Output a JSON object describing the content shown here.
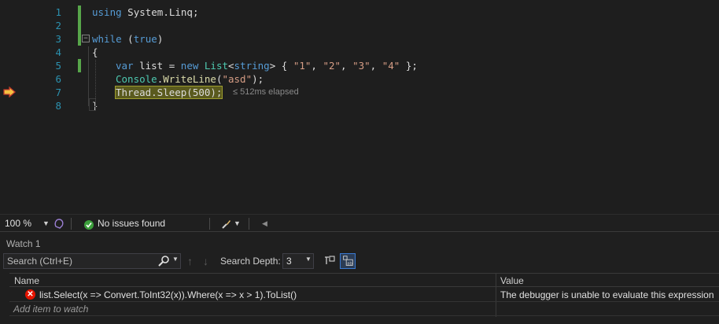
{
  "editor": {
    "lines": [
      {
        "number": "1"
      },
      {
        "number": "2"
      },
      {
        "number": "3"
      },
      {
        "number": "4"
      },
      {
        "number": "5"
      },
      {
        "number": "6"
      },
      {
        "number": "7"
      },
      {
        "number": "8"
      }
    ],
    "tokens": {
      "l1_kw": "using",
      "l1_rest": " System.Linq;",
      "l3_kw": "while",
      "l3_open": " (",
      "l3_true": "true",
      "l3_close": ")",
      "l4": "{",
      "l5_var": "var",
      "l5_a": " list = ",
      "l5_new": "new",
      "l5_sp": " ",
      "l5_list": "List",
      "l5_lt": "<",
      "l5_string": "string",
      "l5_gt": "> { ",
      "l5_s1": "\"1\"",
      "l5_c1": ", ",
      "l5_s2": "\"2\"",
      "l5_c2": ", ",
      "l5_s3": "\"3\"",
      "l5_c3": ", ",
      "l5_s4": "\"4\"",
      "l5_end": " };",
      "l6_console": "Console",
      "l6_dot": ".",
      "l6_write": "WriteLine",
      "l6_open": "(",
      "l6_str": "\"asd\"",
      "l6_close": ");",
      "l7_stmt": "Thread.Sleep(500);",
      "l8": "}"
    },
    "perf_tip": "≤ 512ms elapsed",
    "current_line_icon": "instruction-pointer-arrow-icon",
    "colors": {
      "keyword": "#569cd6",
      "type": "#4ec9b0",
      "string": "#d69d85",
      "method": "#dcdcaa",
      "change_bar": "#57a64a"
    }
  },
  "status_strip": {
    "zoom": "100 %",
    "issues": "No issues found"
  },
  "watch": {
    "title": "Watch 1",
    "search_placeholder": "Search (Ctrl+E)",
    "search_depth_label": "Search Depth:",
    "search_depth_value": "3",
    "columns": {
      "name": "Name",
      "value": "Value"
    },
    "rows": [
      {
        "name": "list.Select(x => Convert.ToInt32(x)).Where(x => x > 1).ToList()",
        "value": "The debugger is unable to evaluate this expression",
        "status": "error"
      }
    ],
    "add_item": "Add item to watch"
  }
}
